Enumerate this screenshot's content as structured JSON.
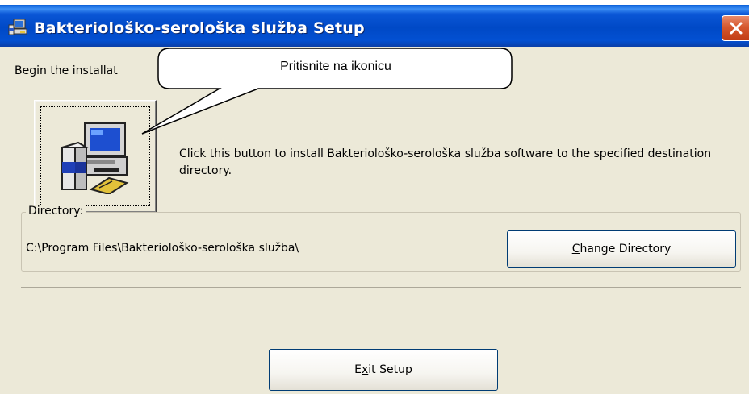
{
  "window": {
    "title": "Bakteriološko-serološka služba Setup"
  },
  "main": {
    "begin_text": "Begin the installat",
    "callout_text": "Pritisnite na ikonicu",
    "install_description": "Click this button to install Bakteriološko-serološka služba software to the specified destination directory."
  },
  "directory": {
    "label": "Directory:",
    "path": "C:\\Program Files\\Bakteriološko-serološka služba\\",
    "change_button": {
      "mnemonic": "C",
      "rest": "hange Directory"
    }
  },
  "exit_button": {
    "before": "E",
    "mnemonic": "x",
    "after": "it Setup"
  },
  "colors": {
    "titlebar": "#0049c6",
    "window_bg": "#ece9d8",
    "close_button": "#d6582e"
  },
  "icons": {
    "title": "setup-computer-icon",
    "install": "computer-install-icon",
    "close": "close-icon"
  }
}
